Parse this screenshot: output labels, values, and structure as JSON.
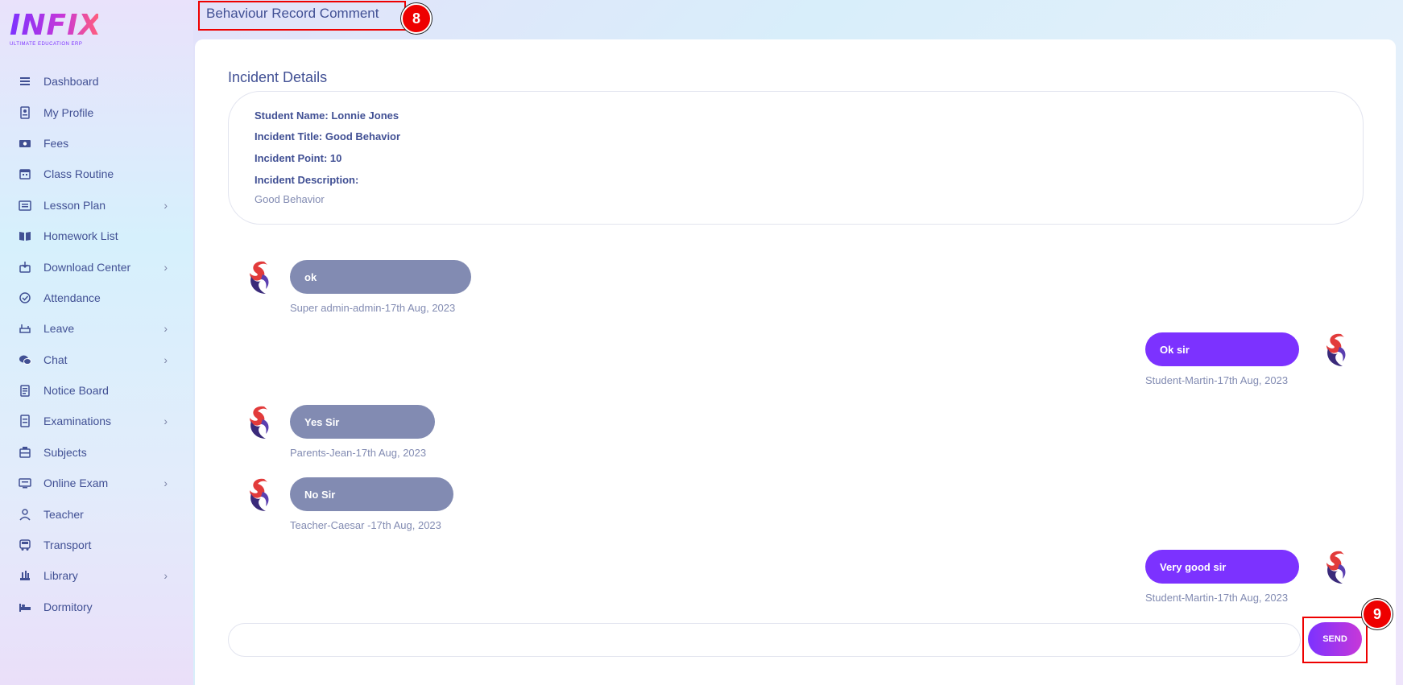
{
  "logo": {
    "text": "INFIX",
    "subtitle": "ULTIMATE EDUCATION ERP"
  },
  "sidebar": {
    "items": [
      {
        "label": "Dashboard",
        "icon": "menu-icon",
        "has_submenu": false
      },
      {
        "label": "My Profile",
        "icon": "profile-card-icon",
        "has_submenu": false
      },
      {
        "label": "Fees",
        "icon": "money-icon",
        "has_submenu": false
      },
      {
        "label": "Class Routine",
        "icon": "calendar-icon",
        "has_submenu": false
      },
      {
        "label": "Lesson Plan",
        "icon": "lesson-icon",
        "has_submenu": true
      },
      {
        "label": "Homework List",
        "icon": "book-icon",
        "has_submenu": false
      },
      {
        "label": "Download Center",
        "icon": "download-icon",
        "has_submenu": true
      },
      {
        "label": "Attendance",
        "icon": "attendance-icon",
        "has_submenu": false
      },
      {
        "label": "Leave",
        "icon": "leave-icon",
        "has_submenu": true
      },
      {
        "label": "Chat",
        "icon": "chat-icon",
        "has_submenu": true
      },
      {
        "label": "Notice Board",
        "icon": "notice-icon",
        "has_submenu": false
      },
      {
        "label": "Examinations",
        "icon": "exam-icon",
        "has_submenu": true
      },
      {
        "label": "Subjects",
        "icon": "subjects-icon",
        "has_submenu": false
      },
      {
        "label": "Online Exam",
        "icon": "online-exam-icon",
        "has_submenu": true
      },
      {
        "label": "Teacher",
        "icon": "teacher-icon",
        "has_submenu": false
      },
      {
        "label": "Transport",
        "icon": "bus-icon",
        "has_submenu": false
      },
      {
        "label": "Library",
        "icon": "library-icon",
        "has_submenu": true
      },
      {
        "label": "Dormitory",
        "icon": "bed-icon",
        "has_submenu": false
      }
    ]
  },
  "header": {
    "title": "Behaviour Record Comment",
    "step_badge": "8"
  },
  "incident": {
    "section_title": "Incident Details",
    "student_name": "Student Name: Lonnie Jones",
    "incident_title": "Incident Title: Good Behavior",
    "incident_point": "Incident Point: 10",
    "description_label": "Incident Description:",
    "description": "Good Behavior"
  },
  "messages": [
    {
      "text": "ok",
      "meta": "Super admin-admin-17th Aug, 2023",
      "side": "left"
    },
    {
      "text": "Ok sir",
      "meta": "Student-Martin-17th Aug, 2023",
      "side": "right"
    },
    {
      "text": "Yes Sir",
      "meta": "Parents-Jean-17th Aug, 2023",
      "side": "left"
    },
    {
      "text": "No Sir",
      "meta": "Teacher-Caesar -17th Aug, 2023",
      "side": "left"
    },
    {
      "text": "Very good sir",
      "meta": "Student-Martin-17th Aug, 2023",
      "side": "right"
    }
  ],
  "composer": {
    "value": "",
    "send_label": "SEND",
    "step_badge": "9"
  },
  "colors": {
    "primary": "#7c32ff",
    "text": "#415094",
    "muted": "#828bb2",
    "highlight": "#ee0000"
  }
}
